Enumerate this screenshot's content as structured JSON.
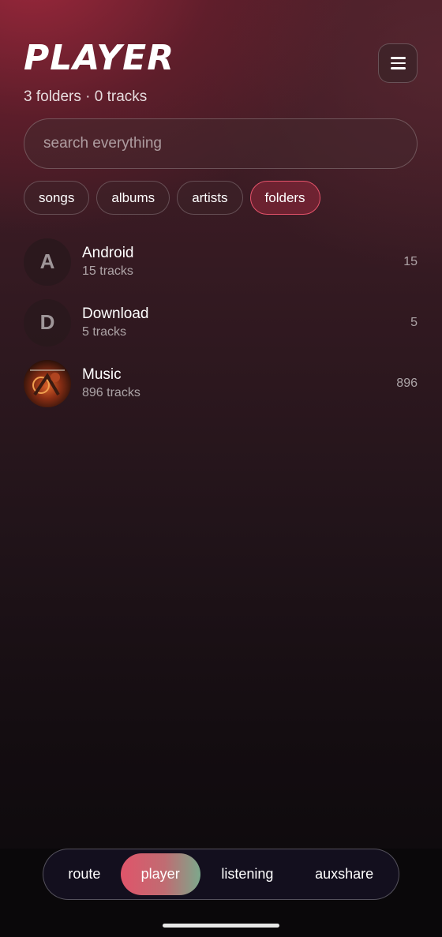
{
  "header": {
    "title": "PLAYER",
    "subtitle": "3 folders · 0 tracks",
    "menu_icon": "hamburger-menu-icon"
  },
  "search": {
    "placeholder": "search everything",
    "value": ""
  },
  "filters": [
    {
      "label": "songs",
      "active": false
    },
    {
      "label": "albums",
      "active": false
    },
    {
      "label": "artists",
      "active": false
    },
    {
      "label": "folders",
      "active": true
    }
  ],
  "folders": [
    {
      "initial": "A",
      "name": "Android",
      "subtitle": "15 tracks",
      "count": "15"
    },
    {
      "initial": "D",
      "name": "Download",
      "subtitle": "5 tracks",
      "count": "5"
    },
    {
      "initial": "",
      "name": "Music",
      "subtitle": "896 tracks",
      "count": "896"
    }
  ],
  "bottom_nav": [
    {
      "label": "route",
      "active": false
    },
    {
      "label": "player",
      "active": true
    },
    {
      "label": "listening",
      "active": false
    },
    {
      "label": "auxshare",
      "active": false
    }
  ],
  "colors": {
    "accent": "#e5536b",
    "nav_gradient_start": "#e0546a",
    "nav_gradient_end": "#7ca88c"
  }
}
